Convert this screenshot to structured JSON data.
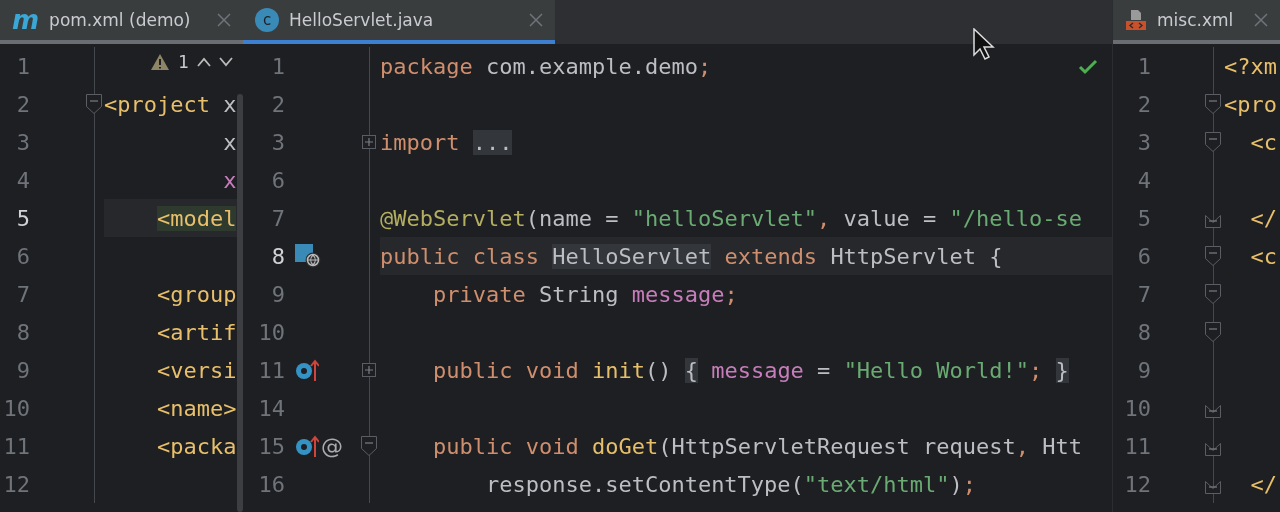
{
  "panes": [
    {
      "kind": "left",
      "focused": false,
      "tabs": [
        {
          "kind": "maven",
          "label": "pom.xml (demo)",
          "icon_text": "m",
          "selected": true
        }
      ],
      "inspection": {
        "count": "1"
      },
      "scrollbar": true,
      "lines": [
        {
          "number": "1"
        },
        {
          "number": "2",
          "foldable": true,
          "expanded": true,
          "tokens": [
            {
              "text": "<project",
              "kind": "tag"
            },
            {
              "text": " x",
              "kind": "plain"
            }
          ]
        },
        {
          "number": "3",
          "tokens": [
            {
              "text": "         x",
              "kind": "plain"
            }
          ]
        },
        {
          "number": "4",
          "tokens": [
            {
              "text": "         x",
              "kind": "field"
            }
          ]
        },
        {
          "number": "5",
          "current": true,
          "tokens": [
            {
              "text": "    <model",
              "kind": "tag",
              "marked": true
            }
          ]
        },
        {
          "number": "6"
        },
        {
          "number": "7",
          "tokens": [
            {
              "text": "    <group",
              "kind": "tag"
            }
          ]
        },
        {
          "number": "8",
          "tokens": [
            {
              "text": "    <artif",
              "kind": "tag"
            }
          ]
        },
        {
          "number": "9",
          "tokens": [
            {
              "text": "    <versi",
              "kind": "tag"
            }
          ]
        },
        {
          "number": "10",
          "tokens": [
            {
              "text": "    <name>",
              "kind": "tag"
            }
          ]
        },
        {
          "number": "11",
          "tokens": [
            {
              "text": "    <packa",
              "kind": "tag"
            }
          ]
        },
        {
          "number": "12"
        }
      ]
    },
    {
      "kind": "middle",
      "focused": true,
      "tabs": [
        {
          "kind": "class",
          "label": "HelloServlet.java",
          "icon_text": "c",
          "selected": true
        }
      ],
      "passed": true,
      "cursor": true,
      "lines": [
        {
          "number": "1",
          "tokens": [
            {
              "text": "package",
              "kind": "keyword"
            },
            {
              "text": " com.example.demo",
              "kind": "plain"
            },
            {
              "text": ";",
              "kind": "keyword"
            }
          ]
        },
        {
          "number": "2"
        },
        {
          "number": "3",
          "foldable": true,
          "expanded": false,
          "tokens": [
            {
              "text": "import",
              "kind": "keyword"
            },
            {
              "text": " ...",
              "kind": "plain",
              "marked": true
            }
          ]
        },
        {
          "number": "6"
        },
        {
          "number": "7",
          "tokens": [
            {
              "text": "@WebServlet",
              "kind": "annotation"
            },
            {
              "text": "(name = ",
              "kind": "plain"
            },
            {
              "text": "\"helloServlet\"",
              "kind": "string"
            },
            {
              "text": ", ",
              "kind": "keyword"
            },
            {
              "text": "value = ",
              "kind": "plain"
            },
            {
              "text": "\"/hello-se",
              "kind": "string"
            }
          ]
        },
        {
          "number": "8",
          "current": true,
          "gutter": [
            {
              "kind": "web"
            }
          ],
          "tokens": [
            {
              "text": "public class",
              "kind": "keyword"
            },
            {
              "text": " HelloServlet",
              "kind": "plain",
              "marked": true
            },
            {
              "text": " extends ",
              "kind": "keyword"
            },
            {
              "text": "HttpServlet {",
              "kind": "plain"
            }
          ]
        },
        {
          "number": "9",
          "tokens": [
            {
              "text": "    private ",
              "kind": "keyword"
            },
            {
              "text": "String ",
              "kind": "plain"
            },
            {
              "text": "message",
              "kind": "field"
            },
            {
              "text": ";",
              "kind": "keyword"
            }
          ]
        },
        {
          "number": "10"
        },
        {
          "number": "11",
          "foldable": true,
          "expanded": false,
          "gutter": [
            {
              "kind": "override"
            }
          ],
          "tokens": [
            {
              "text": "    public void ",
              "kind": "keyword"
            },
            {
              "text": "init",
              "kind": "function"
            },
            {
              "text": "()",
              "kind": "plain"
            },
            {
              "text": " {",
              "kind": "plain",
              "marked": true
            },
            {
              "text": " message",
              "kind": "field"
            },
            {
              "text": " = ",
              "kind": "plain"
            },
            {
              "text": "\"Hello World!\"",
              "kind": "string"
            },
            {
              "text": ";",
              "kind": "keyword"
            },
            {
              "text": " }",
              "kind": "plain",
              "marked": true
            }
          ]
        },
        {
          "number": "14"
        },
        {
          "number": "15",
          "foldable": true,
          "expanded": true,
          "gutter": [
            {
              "kind": "override"
            },
            {
              "kind": "at",
              "text": "@"
            }
          ],
          "tokens": [
            {
              "text": "    public void ",
              "kind": "keyword"
            },
            {
              "text": "doGet",
              "kind": "function"
            },
            {
              "text": "(HttpServletRequest request",
              "kind": "plain"
            },
            {
              "text": ", ",
              "kind": "keyword"
            },
            {
              "text": "Htt",
              "kind": "plain"
            }
          ]
        },
        {
          "number": "16",
          "tokens": [
            {
              "text": "        response.setContentType(",
              "kind": "plain"
            },
            {
              "text": "\"text/html\"",
              "kind": "string"
            },
            {
              "text": ")",
              "kind": "plain"
            },
            {
              "text": ";",
              "kind": "keyword"
            }
          ]
        }
      ]
    },
    {
      "kind": "right",
      "focused": false,
      "tabs": [
        {
          "kind": "xml",
          "label": "misc.xml",
          "selected": true
        }
      ],
      "lines": [
        {
          "number": "1",
          "tokens": [
            {
              "text": "<?xm",
              "kind": "tag"
            }
          ]
        },
        {
          "number": "2",
          "foldable": true,
          "expanded": true,
          "tokens": [
            {
              "text": "<pro",
              "kind": "tag"
            }
          ]
        },
        {
          "number": "3",
          "foldable": true,
          "expanded": true,
          "tokens": [
            {
              "text": "  <c",
              "kind": "tag"
            }
          ]
        },
        {
          "number": "4"
        },
        {
          "number": "5",
          "fold_end": true,
          "tokens": [
            {
              "text": "  </",
              "kind": "tag"
            }
          ]
        },
        {
          "number": "6",
          "foldable": true,
          "expanded": true,
          "tokens": [
            {
              "text": "  <c",
              "kind": "tag"
            }
          ]
        },
        {
          "number": "7",
          "foldable": true,
          "expanded": true
        },
        {
          "number": "8",
          "foldable": true,
          "expanded": true
        },
        {
          "number": "9"
        },
        {
          "number": "10",
          "fold_end": true
        },
        {
          "number": "11",
          "fold_end": true
        },
        {
          "number": "12",
          "fold_end": true,
          "tokens": [
            {
              "text": "  </",
              "kind": "tag"
            }
          ]
        }
      ]
    }
  ]
}
